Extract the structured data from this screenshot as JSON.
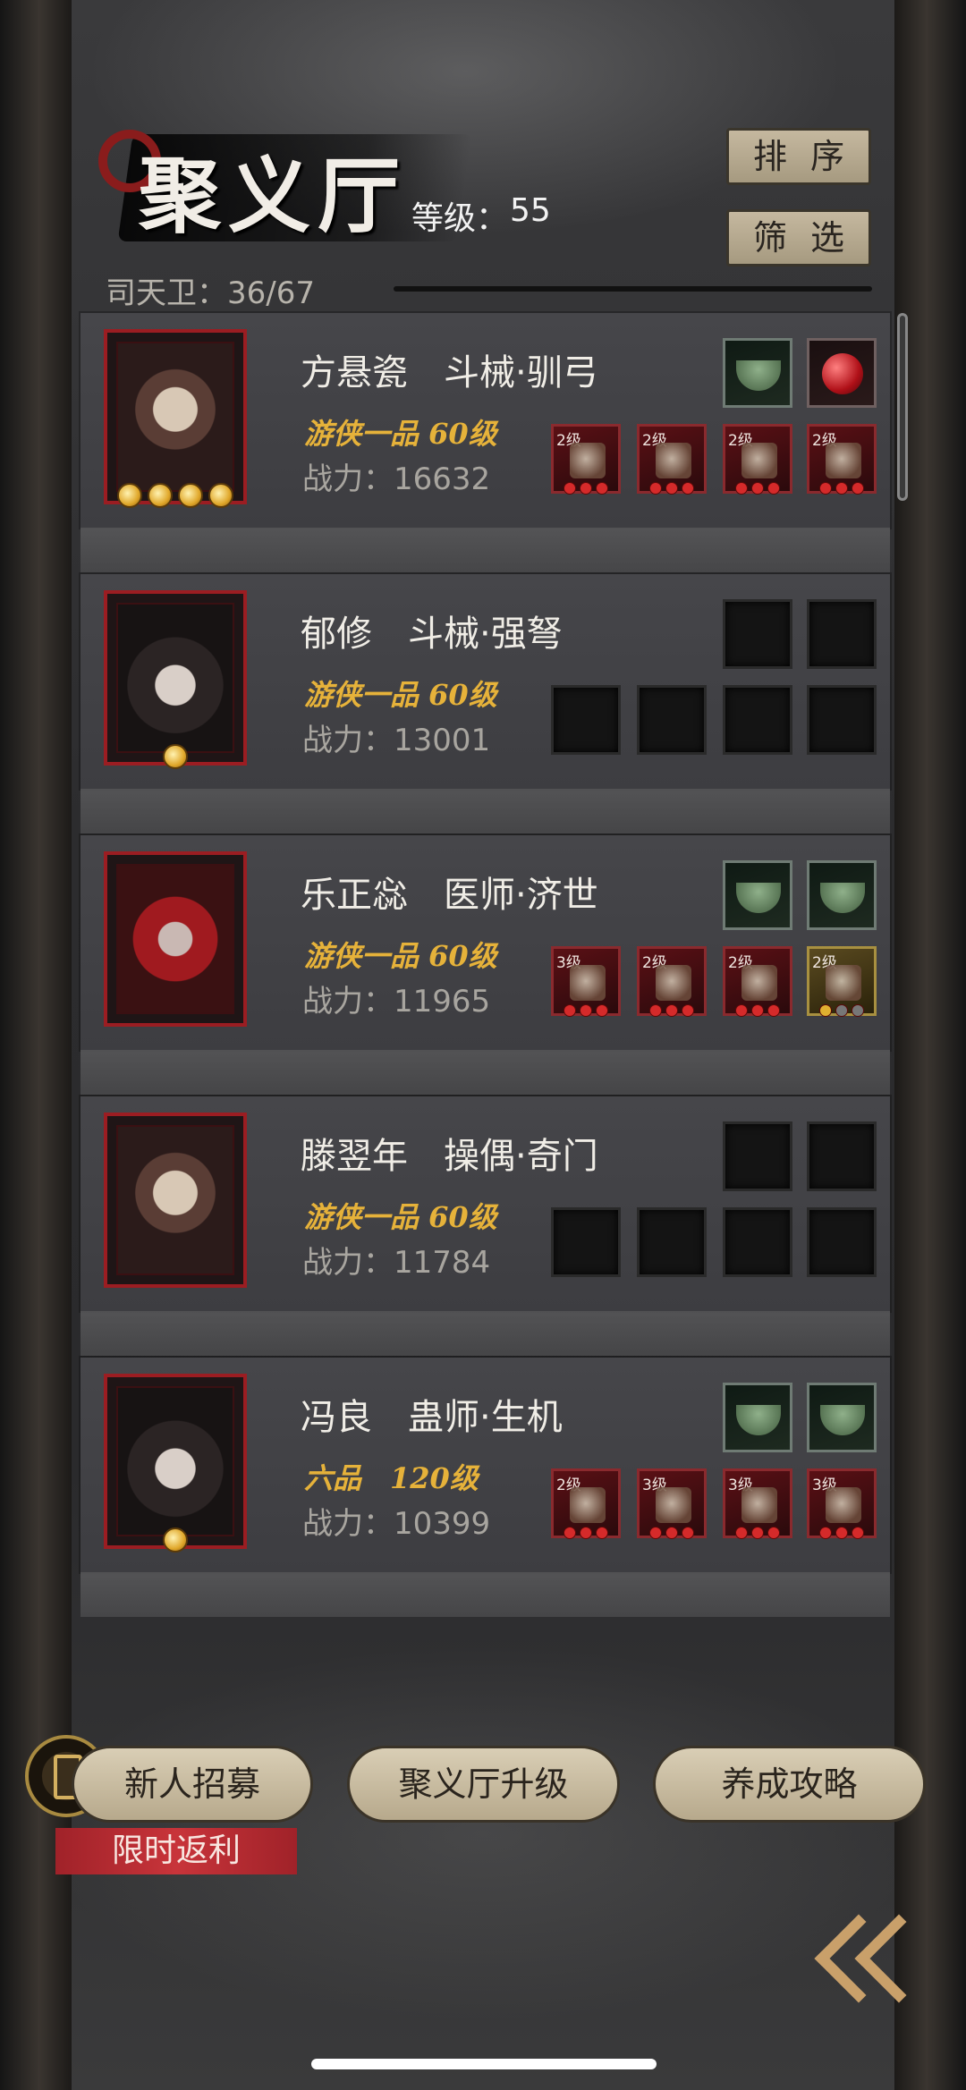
{
  "header": {
    "title": "聚义厅",
    "level_label": "等级：",
    "level_value": "55",
    "guard_label": "司天卫：",
    "guard_value": "36/67",
    "sort_label": "排序",
    "filter_label": "筛选"
  },
  "characters": [
    {
      "name": "方悬瓷　斗械·驯弓",
      "rank": "游侠一品 60级",
      "power": "战力：16632",
      "stars": 4,
      "top_slots": [
        "gem",
        "ruby"
      ],
      "bottom_slots": [
        {
          "type": "item",
          "level": "2级",
          "icon": "crossbow-icon"
        },
        {
          "type": "item",
          "level": "2级",
          "icon": "armor-icon"
        },
        {
          "type": "item",
          "level": "2级",
          "icon": "boots-icon"
        },
        {
          "type": "item",
          "level": "2级",
          "icon": "boots-icon"
        }
      ]
    },
    {
      "name": "郁修　斗械·强弩",
      "rank": "游侠一品 60级",
      "power": "战力：13001",
      "stars": 1,
      "top_slots": [
        "empty",
        "empty"
      ],
      "bottom_slots": [
        {
          "type": "empty"
        },
        {
          "type": "empty"
        },
        {
          "type": "empty"
        },
        {
          "type": "empty"
        }
      ]
    },
    {
      "name": "乐正惢　医师·济世",
      "rank": "游侠一品 60级",
      "power": "战力：11965",
      "stars": 0,
      "top_slots": [
        "gem",
        "gem"
      ],
      "bottom_slots": [
        {
          "type": "item",
          "level": "3级",
          "icon": "gourd-icon"
        },
        {
          "type": "item",
          "level": "2级",
          "icon": "robe-icon"
        },
        {
          "type": "item",
          "level": "2级",
          "icon": "staff-icon"
        },
        {
          "type": "gold",
          "level": "2级",
          "icon": "jade-disc-icon"
        }
      ]
    },
    {
      "name": "滕翌年　操偶·奇门",
      "rank": "游侠一品 60级",
      "power": "战力：11784",
      "stars": 0,
      "top_slots": [
        "empty",
        "empty"
      ],
      "bottom_slots": [
        {
          "type": "empty"
        },
        {
          "type": "empty"
        },
        {
          "type": "empty"
        },
        {
          "type": "empty"
        }
      ]
    },
    {
      "name": "冯良　蛊师·生机",
      "rank": "六品　120级",
      "power": "战力：10399",
      "stars": 1,
      "top_slots": [
        "gem",
        "gem"
      ],
      "bottom_slots": [
        {
          "type": "item",
          "level": "2级",
          "icon": "gourd-icon"
        },
        {
          "type": "item",
          "level": "3级",
          "icon": "armor-icon"
        },
        {
          "type": "item",
          "level": "3级",
          "icon": "horse-icon"
        },
        {
          "type": "item",
          "level": "3级",
          "icon": "horse-icon"
        }
      ]
    }
  ],
  "footer": {
    "recruit_label": "新人招募",
    "upgrade_label": "聚义厅升级",
    "guide_label": "养成攻略",
    "promo_label": "限时返利"
  }
}
